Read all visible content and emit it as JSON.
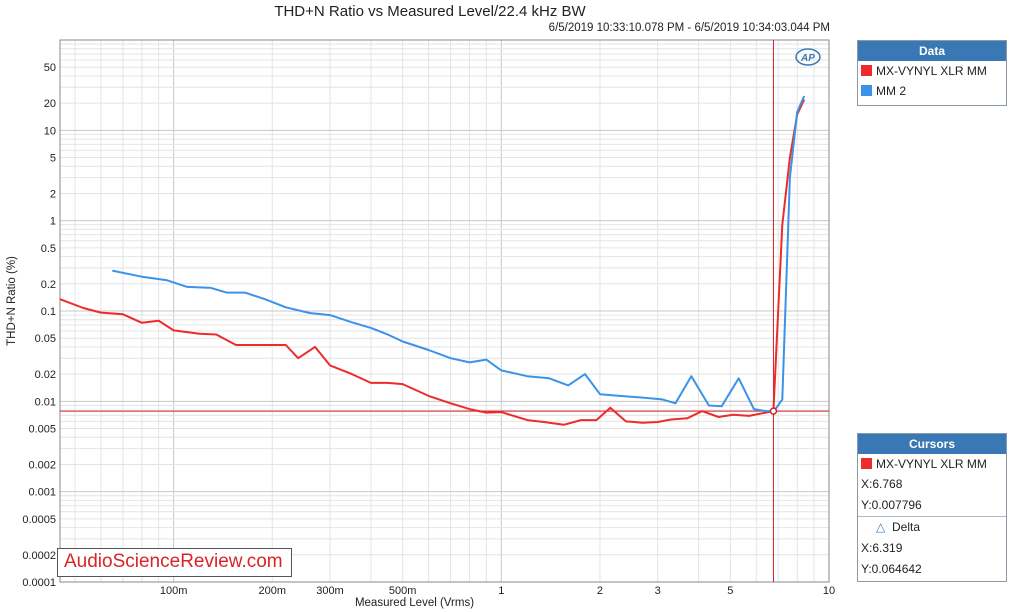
{
  "title": "THD+N Ratio vs Measured Level/22.4 kHz BW",
  "subtitle": "6/5/2019 10:33:10.078 PM - 6/5/2019 10:34:03.044 PM",
  "logo_text": "AP",
  "watermark": "AudioScienceReview.com",
  "legend": {
    "header": "Data",
    "items": [
      {
        "label": "MX-VYNYL XLR MM",
        "color": "#ee2b2b"
      },
      {
        "label": "MM 2",
        "color": "#3a93e8"
      }
    ]
  },
  "cursors": {
    "header": "Cursors",
    "series_label": "MX-VYNYL XLR MM",
    "series_color": "#ee2b2b",
    "x_readout": "X:6.768",
    "y_readout": "Y:0.007796",
    "delta_label": "Delta",
    "delta_x": "X:6.319",
    "delta_y": "Y:0.064642"
  },
  "chart_data": {
    "type": "line",
    "title": "THD+N Ratio vs Measured Level/22.4 kHz BW",
    "xlabel": "Measured Level (Vrms)",
    "ylabel": "THD+N Ratio (%)",
    "x_scale": "log",
    "y_scale": "log",
    "xlim": [
      0.045,
      10
    ],
    "ylim": [
      0.0001,
      100
    ],
    "x_ticks": [
      {
        "v": 0.1,
        "label": "100m"
      },
      {
        "v": 0.2,
        "label": "200m"
      },
      {
        "v": 0.3,
        "label": "300m"
      },
      {
        "v": 0.5,
        "label": "500m"
      },
      {
        "v": 1,
        "label": "1"
      },
      {
        "v": 2,
        "label": "2"
      },
      {
        "v": 3,
        "label": "3"
      },
      {
        "v": 5,
        "label": "5"
      },
      {
        "v": 10,
        "label": "10"
      }
    ],
    "y_ticks": [
      {
        "v": 50,
        "label": "50"
      },
      {
        "v": 20,
        "label": "20"
      },
      {
        "v": 10,
        "label": "10"
      },
      {
        "v": 5,
        "label": "5"
      },
      {
        "v": 2,
        "label": "2"
      },
      {
        "v": 1,
        "label": "1"
      },
      {
        "v": 0.5,
        "label": "0.5"
      },
      {
        "v": 0.2,
        "label": "0.2"
      },
      {
        "v": 0.1,
        "label": "0.1"
      },
      {
        "v": 0.05,
        "label": "0.05"
      },
      {
        "v": 0.02,
        "label": "0.02"
      },
      {
        "v": 0.01,
        "label": "0.01"
      },
      {
        "v": 0.005,
        "label": "0.005"
      },
      {
        "v": 0.002,
        "label": "0.002"
      },
      {
        "v": 0.001,
        "label": "0.001"
      },
      {
        "v": 0.0005,
        "label": "0.0005"
      },
      {
        "v": 0.0002,
        "label": "0.0002"
      },
      {
        "v": 0.0001,
        "label": "0.0001"
      }
    ],
    "grid": true,
    "cursor": {
      "x": 6.768,
      "y": 0.007796
    },
    "series": [
      {
        "name": "MX-VYNYL XLR MM",
        "color": "#ee2b2b",
        "x": [
          0.045,
          0.053,
          0.06,
          0.07,
          0.08,
          0.09,
          0.1,
          0.12,
          0.135,
          0.155,
          0.175,
          0.22,
          0.24,
          0.27,
          0.3,
          0.35,
          0.4,
          0.45,
          0.5,
          0.6,
          0.7,
          0.8,
          0.9,
          1.0,
          1.2,
          1.35,
          1.55,
          1.75,
          1.95,
          2.15,
          2.4,
          2.7,
          3.0,
          3.3,
          3.7,
          4.1,
          4.6,
          5.1,
          5.7,
          6.3,
          6.768,
          7.2,
          7.6,
          8.0,
          8.4
        ],
        "y": [
          0.135,
          0.108,
          0.096,
          0.092,
          0.074,
          0.078,
          0.061,
          0.056,
          0.055,
          0.042,
          0.042,
          0.042,
          0.03,
          0.04,
          0.025,
          0.02,
          0.016,
          0.016,
          0.0155,
          0.0115,
          0.0095,
          0.0082,
          0.0075,
          0.0076,
          0.0062,
          0.0059,
          0.0055,
          0.0062,
          0.0062,
          0.0085,
          0.006,
          0.0058,
          0.0059,
          0.0063,
          0.0065,
          0.0078,
          0.0067,
          0.0071,
          0.0069,
          0.0074,
          0.0078,
          0.9,
          5.0,
          15.0,
          22.0
        ]
      },
      {
        "name": "MM 2",
        "color": "#3a93e8",
        "x": [
          0.065,
          0.08,
          0.095,
          0.11,
          0.13,
          0.145,
          0.165,
          0.19,
          0.22,
          0.26,
          0.3,
          0.35,
          0.4,
          0.45,
          0.5,
          0.6,
          0.7,
          0.8,
          0.9,
          1.0,
          1.2,
          1.4,
          1.6,
          1.8,
          2.0,
          2.3,
          2.7,
          3.1,
          3.4,
          3.8,
          4.3,
          4.7,
          5.3,
          5.9,
          6.4,
          6.8,
          7.2,
          7.6,
          8.0,
          8.4
        ],
        "y": [
          0.28,
          0.24,
          0.22,
          0.185,
          0.18,
          0.16,
          0.16,
          0.135,
          0.11,
          0.095,
          0.09,
          0.075,
          0.065,
          0.055,
          0.046,
          0.037,
          0.03,
          0.027,
          0.029,
          0.022,
          0.019,
          0.018,
          0.015,
          0.02,
          0.012,
          0.0115,
          0.011,
          0.0105,
          0.0095,
          0.019,
          0.009,
          0.0088,
          0.018,
          0.0082,
          0.0078,
          0.0078,
          0.0105,
          3.0,
          16.0,
          24.0
        ]
      }
    ]
  }
}
